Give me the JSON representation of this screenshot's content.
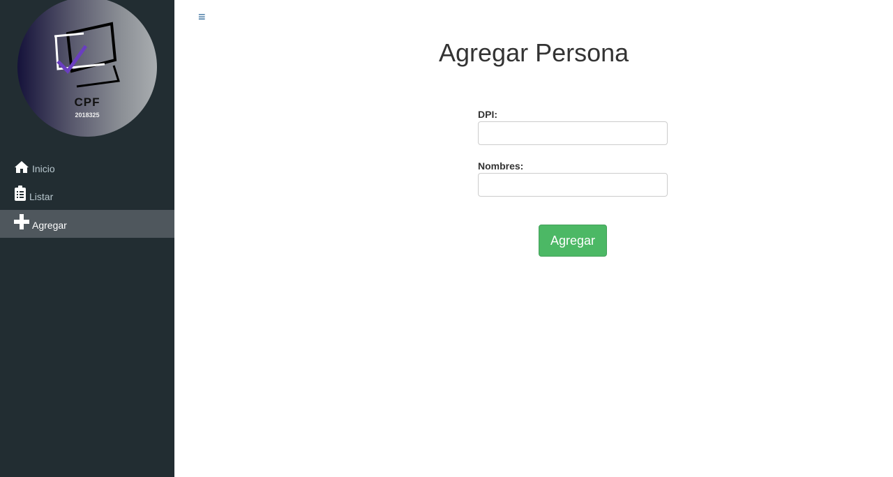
{
  "sidebar": {
    "logo": {
      "title": "CPF",
      "subtitle": "2018325"
    },
    "items": [
      {
        "label": "Inicio",
        "icon": "home-icon"
      },
      {
        "label": "Listar",
        "icon": "clipboard-list-icon"
      },
      {
        "label": "Agregar",
        "icon": "plus-icon",
        "active": true
      }
    ]
  },
  "header": {
    "menu_icon": "≡"
  },
  "form": {
    "title": "Agregar Persona",
    "dpi_label": "DPI:",
    "dpi_value": "",
    "nombres_label": "Nombres:",
    "nombres_value": "",
    "submit_label": "Agregar"
  },
  "colors": {
    "sidebar": "#222d32",
    "active": "#4f575d",
    "button": "#4cb865"
  }
}
